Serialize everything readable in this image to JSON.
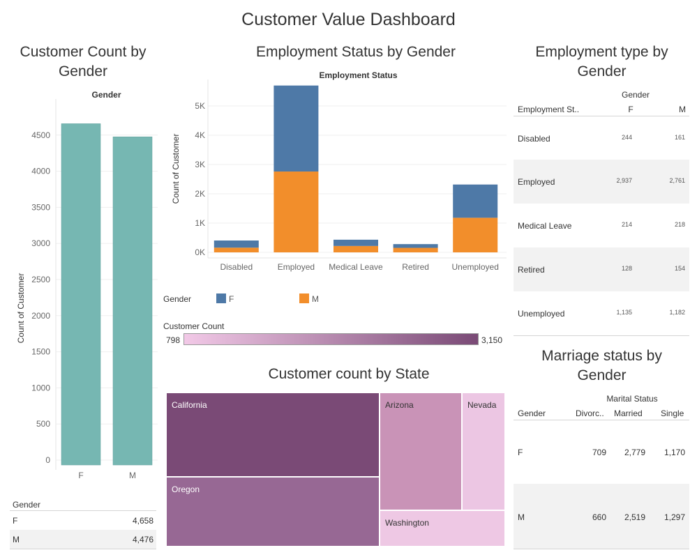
{
  "dashboard_title": "Customer Value Dashboard",
  "gender_count": {
    "title": "Customer Count by Gender",
    "header": "Gender",
    "ylabel": "Count of Customer",
    "table_header": "Gender",
    "rows": [
      {
        "label": "F",
        "value": "4,658"
      },
      {
        "label": "M",
        "value": "4,476"
      }
    ]
  },
  "employment": {
    "title": "Employment Status by Gender",
    "header": "Employment Status",
    "ylabel": "Count of Customer",
    "legend_title": "Gender",
    "legend": [
      {
        "label": "F",
        "color": "#4e79a7"
      },
      {
        "label": "M",
        "color": "#f28e2b"
      }
    ]
  },
  "color_legend": {
    "title": "Customer Count",
    "min": "798",
    "max": "3,150",
    "color_low": "#f2c9e7",
    "color_high": "#7a4a76"
  },
  "state": {
    "title": "Customer count by State",
    "tiles": [
      {
        "label": "California",
        "value": 3150
      },
      {
        "label": "Oregon",
        "value": 2601
      },
      {
        "label": "Arizona",
        "value": 1703
      },
      {
        "label": "Nevada",
        "value": 882
      },
      {
        "label": "Washington",
        "value": 798
      }
    ]
  },
  "employment_table": {
    "title": "Employment type by Gender",
    "col_group": "Gender",
    "row_header": "Employment St..",
    "cols": [
      "F",
      "M"
    ],
    "rows": [
      {
        "label": "Disabled",
        "f": "244",
        "m": "161"
      },
      {
        "label": "Employed",
        "f": "2,937",
        "m": "2,761"
      },
      {
        "label": "Medical Leave",
        "f": "214",
        "m": "218"
      },
      {
        "label": "Retired",
        "f": "128",
        "m": "154"
      },
      {
        "label": "Unemployed",
        "f": "1,135",
        "m": "1,182"
      }
    ]
  },
  "marital_table": {
    "title": "Marriage status by Gender",
    "col_group": "Marital Status",
    "row_header": "Gender",
    "cols": [
      "Divorc..",
      "Married",
      "Single"
    ],
    "rows": [
      {
        "label": "F",
        "d": "709",
        "ma": "2,779",
        "s": "1,170"
      },
      {
        "label": "M",
        "d": "660",
        "ma": "2,519",
        "s": "1,297"
      }
    ]
  },
  "chart_data": [
    {
      "type": "bar",
      "title": "Customer Count by Gender",
      "categories": [
        "F",
        "M"
      ],
      "values": [
        4658,
        4476
      ],
      "xlabel": "Gender",
      "ylabel": "Count of Customer",
      "ylim": [
        0,
        5000
      ],
      "yticks": [
        "0",
        "500",
        "1000",
        "1500",
        "2000",
        "2500",
        "3000",
        "3500",
        "4000",
        "4500"
      ],
      "color": "#76b7b2"
    },
    {
      "type": "bar",
      "stacked": true,
      "title": "Employment Status by Gender",
      "categories": [
        "Disabled",
        "Employed",
        "Medical Leave",
        "Retired",
        "Unemployed"
      ],
      "series": [
        {
          "name": "M",
          "values": [
            161,
            2761,
            218,
            154,
            1182
          ],
          "color": "#f28e2b"
        },
        {
          "name": "F",
          "values": [
            244,
            2937,
            214,
            128,
            1135
          ],
          "color": "#4e79a7"
        }
      ],
      "xlabel": "Employment Status",
      "ylabel": "Count of Customer",
      "ylim": [
        0,
        6000
      ],
      "yticks": [
        "0K",
        "1K",
        "2K",
        "3K",
        "4K",
        "5K"
      ]
    },
    {
      "type": "heatmap",
      "subtype": "treemap",
      "title": "Customer count by State",
      "categories": [
        "California",
        "Oregon",
        "Arizona",
        "Nevada",
        "Washington"
      ],
      "values": [
        3150,
        2601,
        1703,
        882,
        798
      ]
    }
  ]
}
